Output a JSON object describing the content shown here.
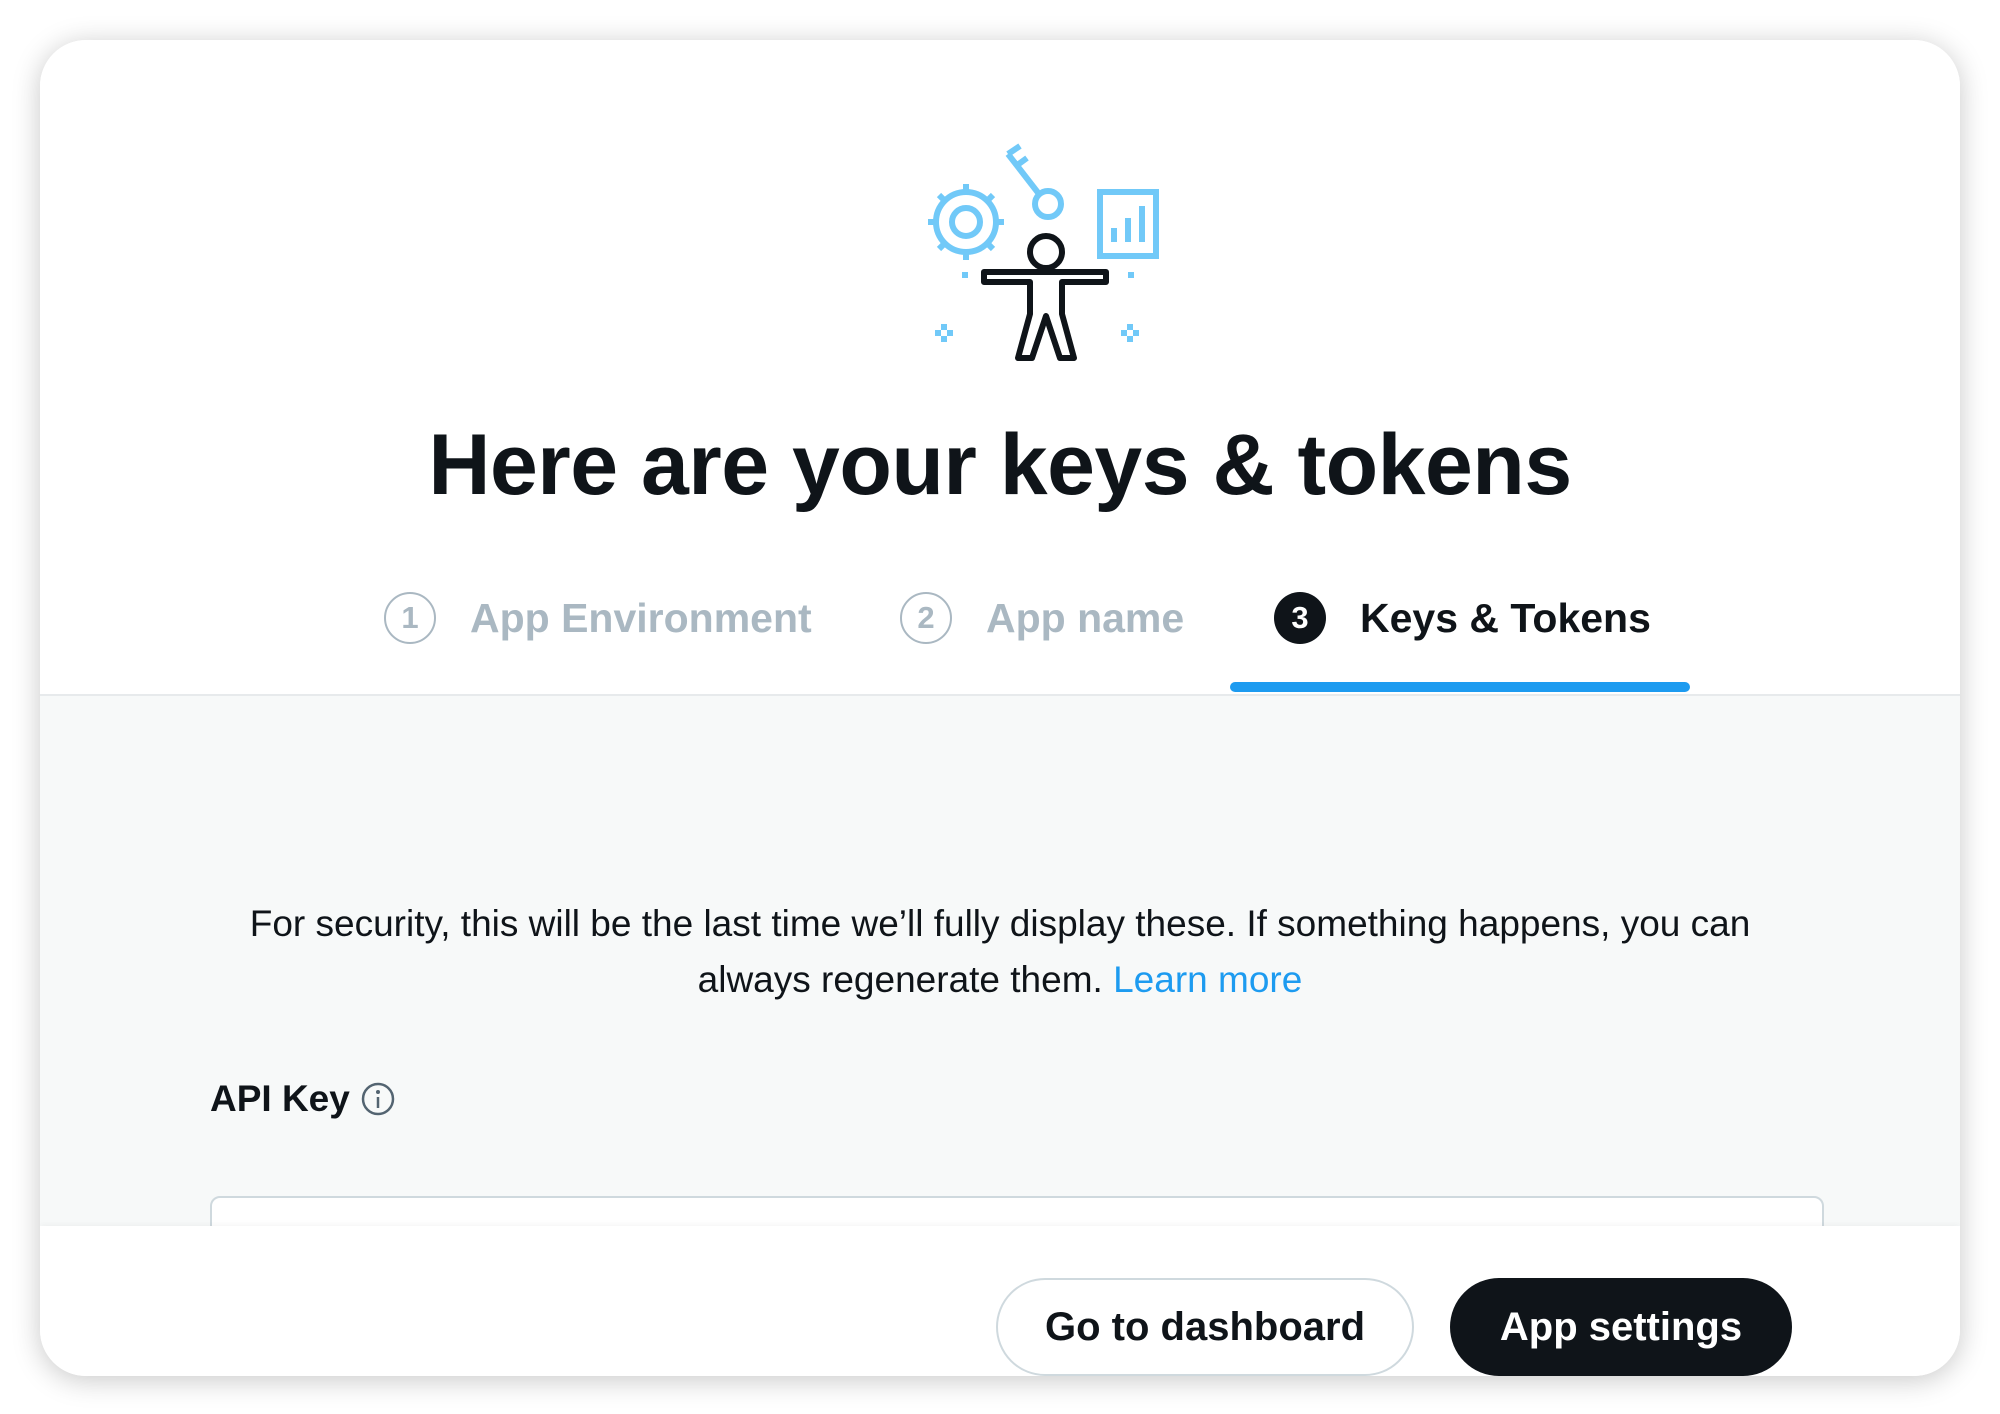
{
  "colors": {
    "accent": "#1d9bf0",
    "text": "#0f1419",
    "muted": "#aab8c2",
    "illustration_blue": "#71c9f8"
  },
  "header": {
    "illustration": "developer-keys-illustration",
    "title": "Here are your keys & tokens"
  },
  "steps": [
    {
      "number": "1",
      "label": "App Environment",
      "state": "inactive"
    },
    {
      "number": "2",
      "label": "App name",
      "state": "inactive"
    },
    {
      "number": "3",
      "label": "Keys & Tokens",
      "state": "active"
    }
  ],
  "notice": {
    "line1": "For security, this will be the last time we’ll fully display these. If something happens, you can",
    "line2": "always regenerate them.",
    "link": "Learn more"
  },
  "api_key": {
    "label": "API Key",
    "info_icon": "info-icon",
    "value": ""
  },
  "footer": {
    "dashboard_button": "Go to dashboard",
    "settings_button": "App settings"
  }
}
